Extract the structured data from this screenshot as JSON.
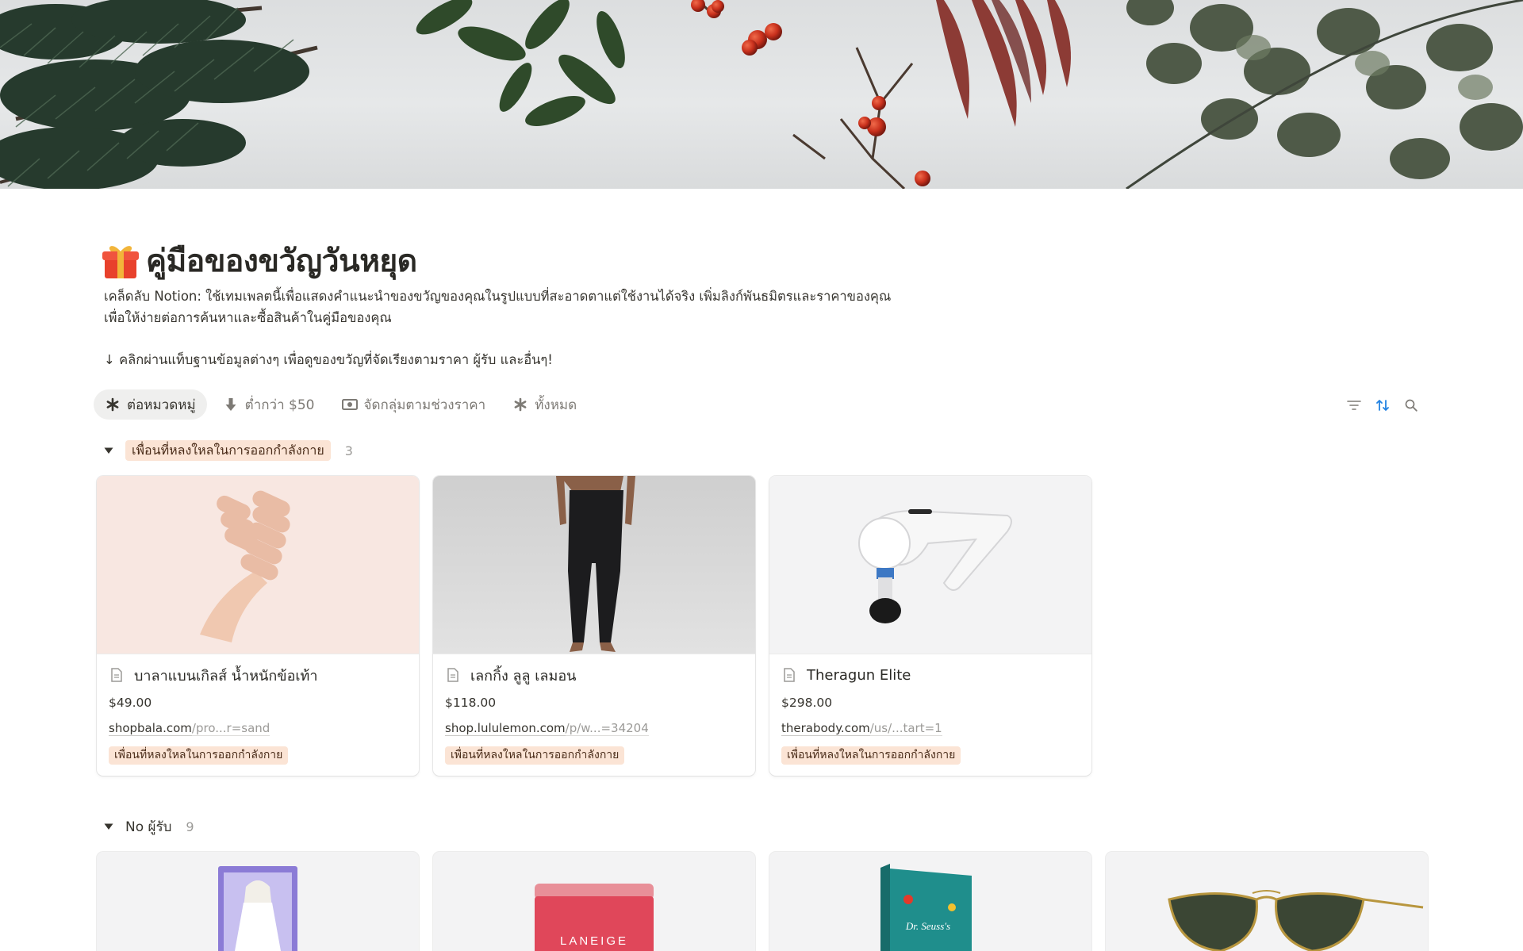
{
  "page": {
    "title": "คู่มือของขวัญวันหยุด",
    "title_icon": "gift-icon",
    "description_line1": "เคล็ดลับ Notion: ใช้เทมเพลตนี้เพื่อแสดงคำแนะนำของขวัญของคุณในรูปแบบที่สะอาดตาแต่ใช้งานได้จริง เพิ่มลิงก์พันธมิตรและราคาของคุณ",
    "description_line2": "เพื่อให้ง่ายต่อการค้นหาและซื้อสินค้าในคู่มือของคุณ",
    "hint": "↓ คลิกผ่านแท็บฐานข้อมูลต่างๆ เพื่อดูของขวัญที่จัดเรียงตามราคา ผู้รับ และอื่นๆ!"
  },
  "views": [
    {
      "label": "ต่อหมวดหมู่",
      "icon": "asterisk-icon",
      "active": true
    },
    {
      "label": "ต่ำกว่า $50",
      "icon": "arrow-down-icon",
      "active": false
    },
    {
      "label": "จัดกลุ่มตามช่วงราคา",
      "icon": "money-icon",
      "active": false
    },
    {
      "label": "ทั้งหมด",
      "icon": "asterisk-icon",
      "active": false
    }
  ],
  "toolbar": {
    "filter_icon": "filter-icon",
    "sort_icon": "sort-icon",
    "search_icon": "search-icon"
  },
  "groups": [
    {
      "name": "เพื่อนที่หลงใหลในการออกกำลังกาย",
      "count": "3",
      "cards": [
        {
          "title": "บาลาแบนเกิลส์ น้ำหนักข้อเท้า",
          "price": "$49.00",
          "link_domain": "shopbala.com",
          "link_path": "/pro...r=sand",
          "tag": "เพื่อนที่หลงใหลในการออกกำลังกาย"
        },
        {
          "title": "เลกกิ้ง ลูลู เลมอน",
          "price": "$118.00",
          "link_domain": "shop.lululemon.com",
          "link_path": "/p/w...=34204",
          "tag": "เพื่อนที่หลงใหลในการออกกำลังกาย"
        },
        {
          "title": "Theragun Elite",
          "price": "$298.00",
          "link_domain": "therabody.com",
          "link_path": "/us/...tart=1",
          "tag": "เพื่อนที่หลงใหลในการออกกำลังกาย"
        }
      ]
    },
    {
      "name": "No ผู้รับ",
      "count": "9",
      "cards": [
        {
          "image_text": ""
        },
        {
          "image_text": "LANEIGE"
        },
        {
          "image_text": "Dr. Seuss's"
        },
        {
          "image_text": ""
        }
      ]
    }
  ],
  "colors": {
    "tag_bg": "#fbe4d5",
    "tag_text": "#4a2c19",
    "active_tab_bg": "#efefee",
    "sort_icon": "#2383e2"
  }
}
